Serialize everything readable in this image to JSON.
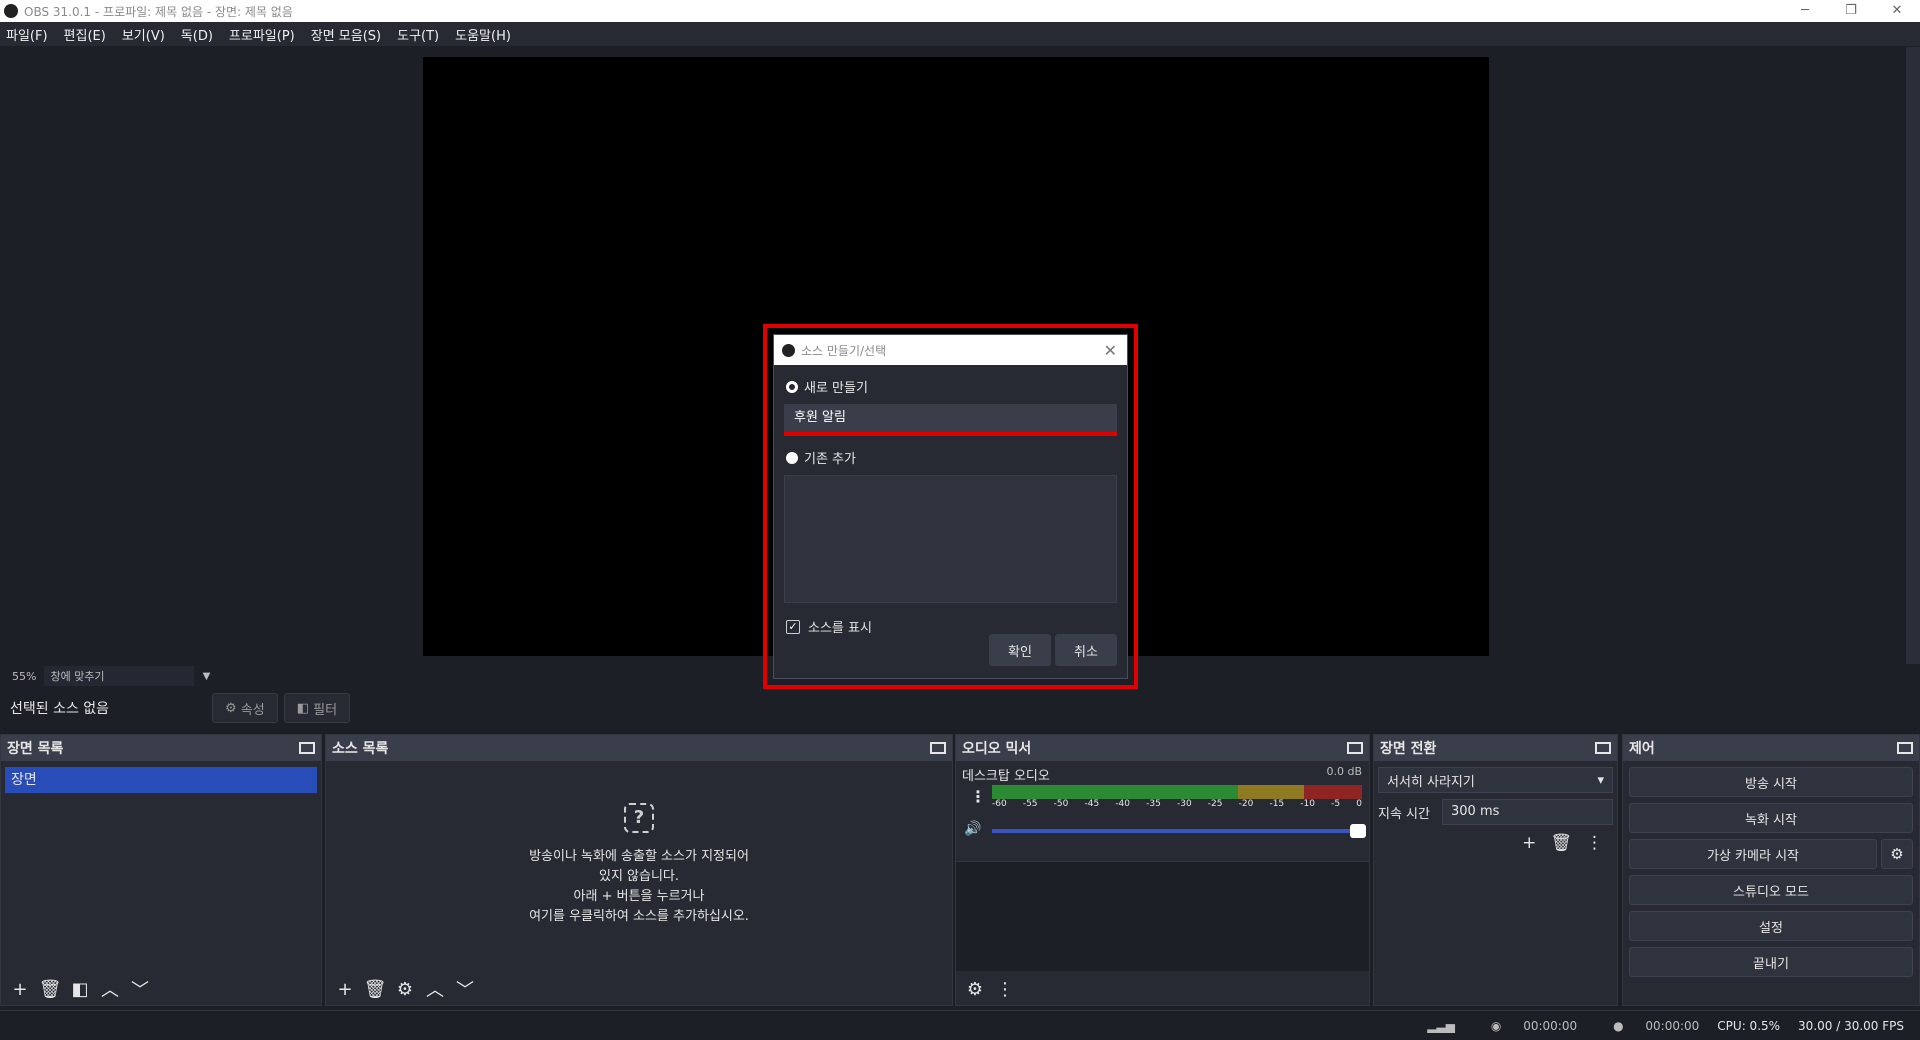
{
  "window": {
    "title": "OBS 31.0.1 - 프로파일: 제목 없음 - 장면: 제목 없음",
    "minimize": "─",
    "restore": "❐",
    "close": "✕"
  },
  "menu": [
    "파일(F)",
    "편집(E)",
    "보기(V)",
    "독(D)",
    "프로파일(P)",
    "장면 모음(S)",
    "도구(T)",
    "도움말(H)"
  ],
  "zoom": {
    "value": "55%",
    "fit": "창에 맞추기"
  },
  "source_toolbar": {
    "no_selection": "선택된 소스 없음",
    "properties": "속성",
    "filters": "필터"
  },
  "scenes": {
    "title": "장면 목록",
    "items": [
      "장면"
    ]
  },
  "sources": {
    "title": "소스 목록",
    "empty_lines": [
      "방송이나 녹화에 송출할 소스가 지정되어",
      "있지 않습니다.",
      "아래 + 버튼을 누르거나",
      "여기를 우클릭하여 소스를 추가하십시오."
    ]
  },
  "mixer": {
    "title": "오디오 믹서",
    "channel": "데스크탑 오디오",
    "level": "0.0 dB",
    "ticks": [
      "-60",
      "-55",
      "-50",
      "-45",
      "-40",
      "-35",
      "-30",
      "-25",
      "-20",
      "-15",
      "-10",
      "-5",
      "0"
    ]
  },
  "transitions": {
    "title": "장면 전환",
    "selected": "서서히 사라지기",
    "duration_label": "지속 시간",
    "duration_value": "300 ms"
  },
  "controls": {
    "title": "제어",
    "start_stream": "방송 시작",
    "start_record": "녹화 시작",
    "start_virtualcam": "가상 카메라 시작",
    "studio_mode": "스튜디오 모드",
    "settings": "설정",
    "exit": "끝내기"
  },
  "status": {
    "stream_time": "00:00:00",
    "record_time": "00:00:00",
    "cpu": "CPU: 0.5%",
    "fps": "30.00 / 30.00 FPS"
  },
  "dialog": {
    "title": "소스 만들기/선택",
    "create_new": "새로 만들기",
    "name_value": "후원 알림",
    "add_existing": "기존 추가",
    "visible_label": "소스를 표시",
    "visible_checked": true,
    "ok": "확인",
    "cancel": "취소"
  },
  "colors": {
    "accent": "#284cb8",
    "highlight": "#e00000",
    "bg": "#1d1f26",
    "panel": "#272a33"
  }
}
